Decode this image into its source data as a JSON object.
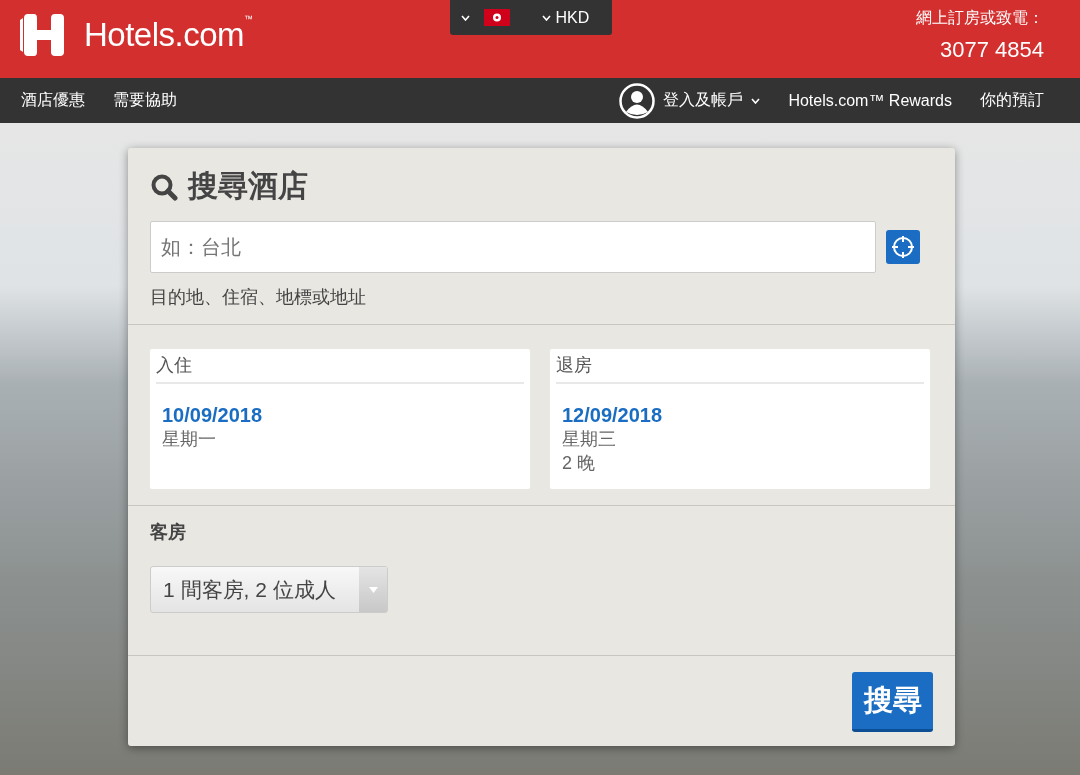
{
  "header": {
    "logo": "Hotels.com$^{™}$",
    "locale": {
      "currency": "HKD"
    },
    "contact_label": "網上訂房或致電：",
    "phone": "3077 4854"
  },
  "nav": {
    "left": [
      "酒店優惠",
      "需要協助"
    ],
    "account": "登入及帳戶",
    "rewards": "Hotels.com™ Rewards",
    "bookings": "你的預訂"
  },
  "search": {
    "title": "搜尋酒店",
    "destination": {
      "placeholder": "如：台北",
      "hint": "目的地、住宿、地標或地址"
    },
    "dates": [
      {
        "label": "入住",
        "date": "10/09/2018",
        "weekday": "星期一"
      },
      {
        "label": "退房",
        "date": "12/09/2018",
        "weekday": "星期三",
        "nights": "2 晚"
      }
    ],
    "rooms": {
      "label": "客房",
      "value": "1 間客房, 2 位成人"
    },
    "button": "搜尋"
  }
}
